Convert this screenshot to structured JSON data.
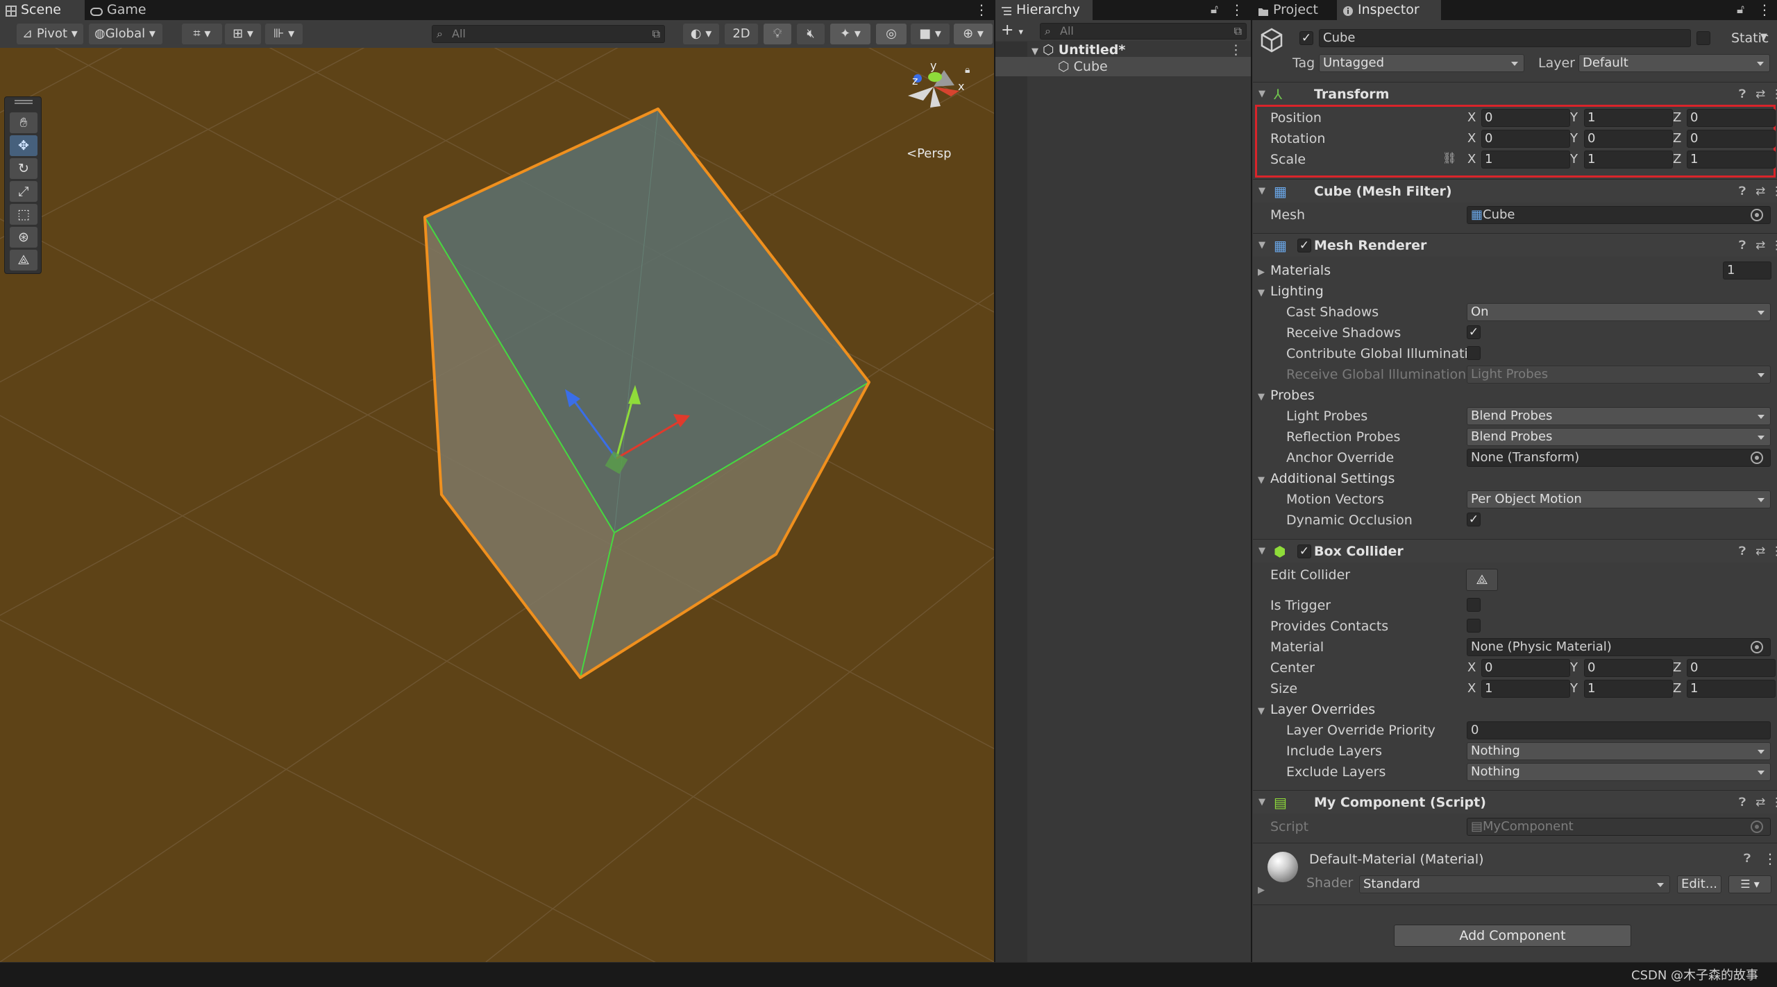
{
  "scene_tabs": {
    "scene": "Scene",
    "game": "Game"
  },
  "scene_toolbar": {
    "pivot": "Pivot",
    "global": "Global",
    "search_placeholder": "All",
    "mode_2d": "2D"
  },
  "gizmo": {
    "x": "x",
    "y": "y",
    "z": "z",
    "persp": "Persp"
  },
  "hierarchy": {
    "tab": "Hierarchy",
    "search_placeholder": "All",
    "scene_name": "Untitled*",
    "items": [
      "Cube"
    ]
  },
  "project_tab": "Project",
  "inspector": {
    "tab": "Inspector",
    "object_name": "Cube",
    "static_label": "Static",
    "tag_label": "Tag",
    "tag_value": "Untagged",
    "layer_label": "Layer",
    "layer_value": "Default",
    "transform": {
      "title": "Transform",
      "position_label": "Position",
      "rotation_label": "Rotation",
      "scale_label": "Scale",
      "position": {
        "x": "0",
        "y": "1",
        "z": "0"
      },
      "rotation": {
        "x": "0",
        "y": "0",
        "z": "0"
      },
      "scale": {
        "x": "1",
        "y": "1",
        "z": "1"
      }
    },
    "mesh_filter": {
      "title": "Cube (Mesh Filter)",
      "mesh_label": "Mesh",
      "mesh_value": "Cube"
    },
    "mesh_renderer": {
      "title": "Mesh Renderer",
      "materials_label": "Materials",
      "materials_count": "1",
      "lighting_label": "Lighting",
      "cast_shadows_label": "Cast Shadows",
      "cast_shadows_value": "On",
      "receive_shadows_label": "Receive Shadows",
      "contribute_gi_label": "Contribute Global Illumination",
      "receive_gi_label": "Receive Global Illumination",
      "receive_gi_value": "Light Probes",
      "probes_label": "Probes",
      "light_probes_label": "Light Probes",
      "light_probes_value": "Blend Probes",
      "reflection_probes_label": "Reflection Probes",
      "reflection_probes_value": "Blend Probes",
      "anchor_override_label": "Anchor Override",
      "anchor_override_value": "None (Transform)",
      "additional_label": "Additional Settings",
      "motion_vectors_label": "Motion Vectors",
      "motion_vectors_value": "Per Object Motion",
      "dynamic_occlusion_label": "Dynamic Occlusion"
    },
    "box_collider": {
      "title": "Box Collider",
      "edit_collider_label": "Edit Collider",
      "is_trigger_label": "Is Trigger",
      "provides_contacts_label": "Provides Contacts",
      "material_label": "Material",
      "material_value": "None (Physic Material)",
      "center_label": "Center",
      "size_label": "Size",
      "center": {
        "x": "0",
        "y": "0",
        "z": "0"
      },
      "size": {
        "x": "1",
        "y": "1",
        "z": "1"
      },
      "layer_overrides_label": "Layer Overrides",
      "priority_label": "Layer Override Priority",
      "priority_value": "0",
      "include_label": "Include Layers",
      "include_value": "Nothing",
      "exclude_label": "Exclude Layers",
      "exclude_value": "Nothing"
    },
    "my_component": {
      "title": "My Component (Script)",
      "script_label": "Script",
      "script_value": "MyComponent"
    },
    "material": {
      "title": "Default-Material (Material)",
      "shader_label": "Shader",
      "shader_value": "Standard",
      "edit_label": "Edit..."
    },
    "add_component": "Add Component"
  },
  "watermark": "CSDN @木子森的故事",
  "colors": {
    "scene_bg": "#5e4317",
    "selection_outline": "#f0901e",
    "highlight_box": "#d9242a"
  }
}
